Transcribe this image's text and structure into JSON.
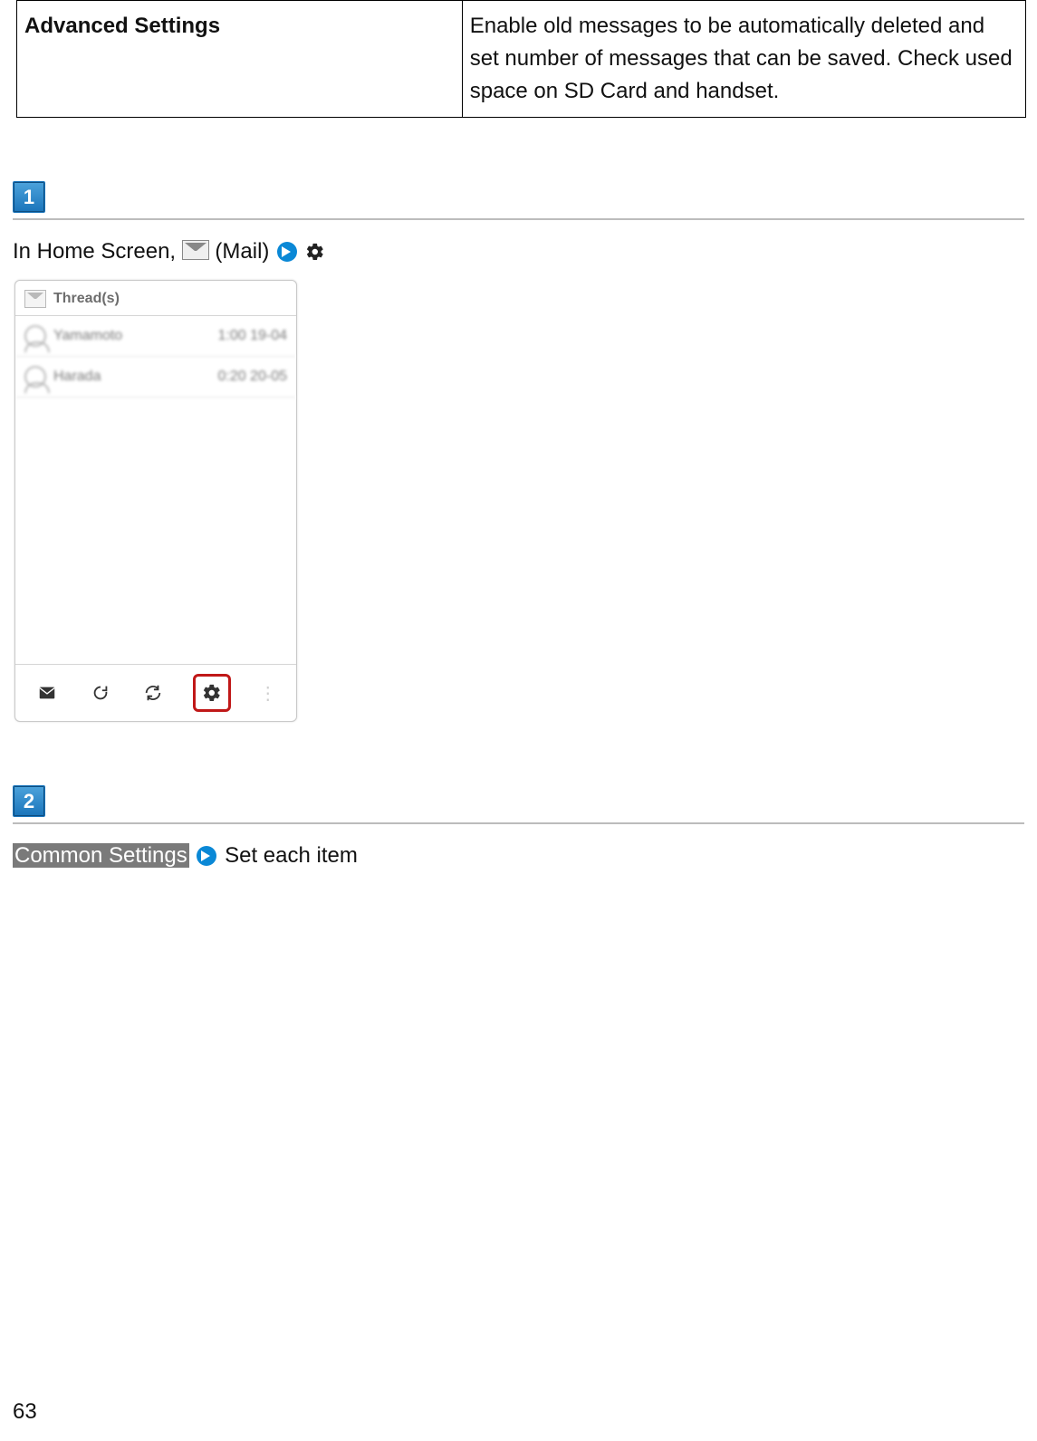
{
  "table": {
    "left": "Advanced Settings",
    "right": "Enable old messages to be automatically deleted and set number of messages that can be saved. Check used space on SD Card and handset."
  },
  "step1": {
    "number": "1",
    "line_prefix": "In Home Screen, ",
    "mail_label": " (Mail)",
    "phone": {
      "header": "Thread(s)",
      "threads": [
        {
          "name": "Yamamoto",
          "time": "1:00 19-04"
        },
        {
          "name": "Harada",
          "time": "0:20 20-05"
        }
      ]
    }
  },
  "step2": {
    "number": "2",
    "highlight": "Common Settings",
    "suffix": " Set each item"
  },
  "page_number": "63"
}
